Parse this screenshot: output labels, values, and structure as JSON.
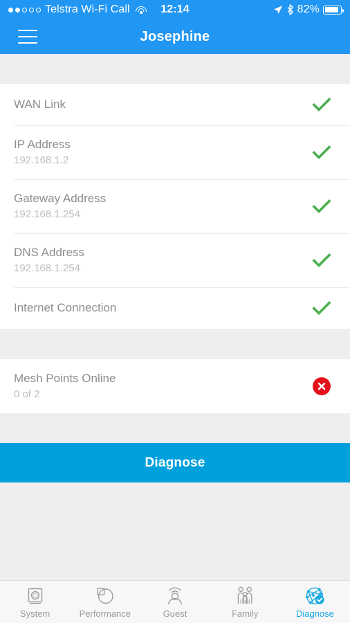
{
  "status_bar": {
    "signal_dots": [
      true,
      true,
      false,
      false,
      false
    ],
    "carrier": "Telstra Wi-Fi Call",
    "wifi_icon": "wifi-icon",
    "time": "12:14",
    "location_icon": "location-arrow-icon",
    "bluetooth_icon": "bluetooth-icon",
    "battery_percent": "82%",
    "battery_level": 82
  },
  "navbar": {
    "menu_icon": "hamburger-menu-icon",
    "title": "Josephine",
    "background_color": "#2196f3"
  },
  "sections": [
    {
      "rows": [
        {
          "title": "WAN Link",
          "value": "",
          "status": "ok"
        },
        {
          "title": "IP Address",
          "value": "192.168.1.2",
          "status": "ok"
        },
        {
          "title": "Gateway Address",
          "value": "192.168.1.254",
          "status": "ok"
        },
        {
          "title": "DNS Address",
          "value": "192.168.1.254",
          "status": "ok"
        },
        {
          "title": "Internet Connection",
          "value": "",
          "status": "ok"
        }
      ]
    },
    {
      "rows": [
        {
          "title": "Mesh Points Online",
          "value": "0 of 2",
          "status": "error"
        }
      ]
    }
  ],
  "primary_button": {
    "label": "Diagnose",
    "color": "#00a0dc"
  },
  "tabbar": {
    "items": [
      {
        "label": "System",
        "icon": "system-icon",
        "active": false
      },
      {
        "label": "Performance",
        "icon": "performance-pie-icon",
        "active": false
      },
      {
        "label": "Guest",
        "icon": "guest-user-icon",
        "active": false
      },
      {
        "label": "Family",
        "icon": "family-icon",
        "active": false
      },
      {
        "label": "Diagnose",
        "icon": "diagnose-network-icon",
        "active": true
      }
    ]
  },
  "colors": {
    "ok_green": "#4caf50",
    "error_red": "#e4111b",
    "accent_blue": "#17a8e3",
    "header_blue": "#2196f3",
    "background_gray": "#efedee"
  }
}
